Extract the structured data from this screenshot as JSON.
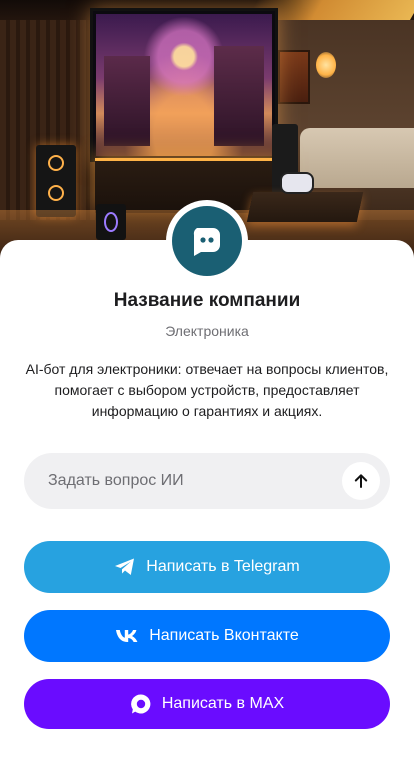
{
  "hero": {
    "icon": "home-theater-photo"
  },
  "profile": {
    "avatar_icon": "chat-bot-icon",
    "avatar_color": "#1a5f73",
    "company_name": "Название компании",
    "category": "Электроника",
    "description": "AI-бот для электроники: отвечает на вопросы клиентов, помогает с выбором устройств, предоставляет информацию о гарантиях и акциях."
  },
  "ask": {
    "placeholder": "Задать вопрос ИИ",
    "value": "",
    "send_icon": "arrow-up-icon"
  },
  "buttons": {
    "telegram": {
      "label": "Написать в Telegram",
      "icon": "telegram-icon",
      "color": "#27a2e0"
    },
    "vk": {
      "label": "Написать Вконтакте",
      "icon": "vk-icon",
      "color": "#0077ff"
    },
    "max": {
      "label": "Написать в MAX",
      "icon": "max-icon",
      "color": "#6a0cff"
    }
  }
}
